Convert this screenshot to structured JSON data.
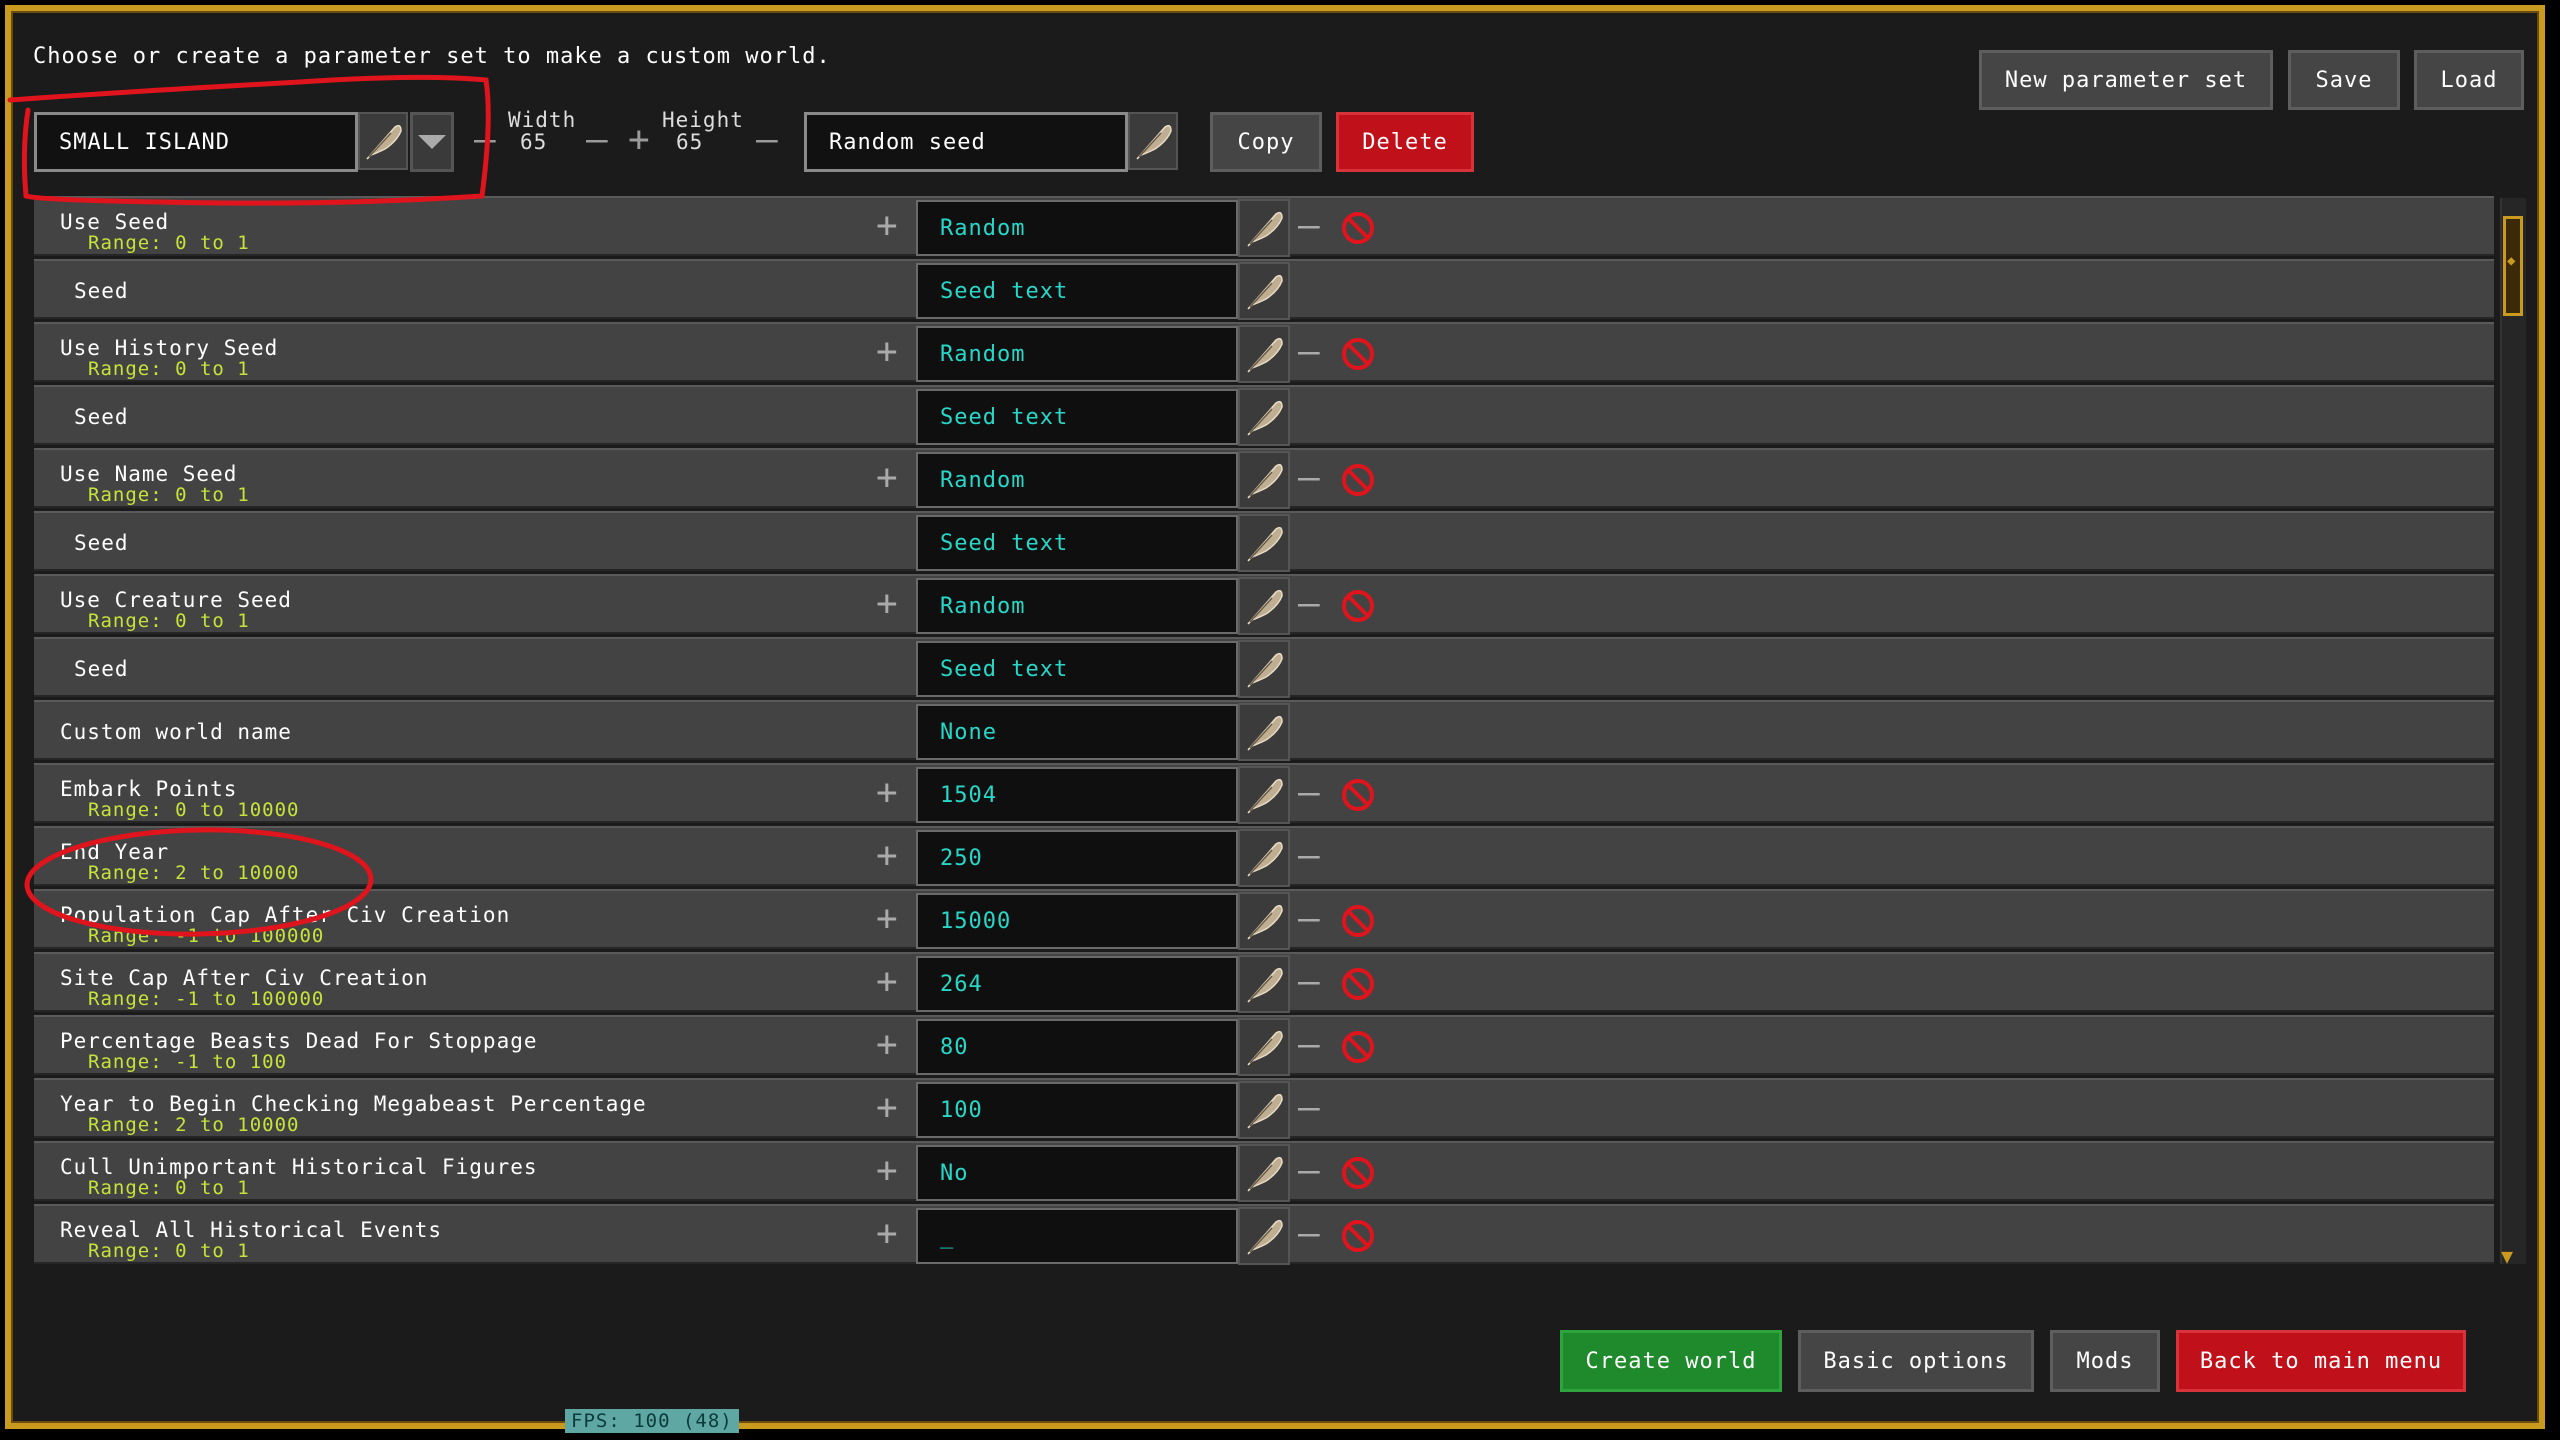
{
  "header": {
    "title": "Choose or create a parameter set to make a custom world.",
    "preset_name": "SMALL ISLAND",
    "width_label": "Width",
    "width_value": "65",
    "height_label": "Height",
    "height_value": "65",
    "seed_field": "Random seed",
    "copy_label": "Copy",
    "delete_label": "Delete",
    "new_param_label": "New parameter set",
    "save_label": "Save",
    "load_label": "Load"
  },
  "rows": [
    {
      "name": "Use Seed",
      "range": "Range: 0 to 1",
      "value": "Random",
      "has_plus": true,
      "has_minus": true,
      "has_forbid": true
    },
    {
      "name": "Seed",
      "range": "",
      "value": "Seed text",
      "has_plus": false,
      "has_minus": false,
      "has_forbid": false
    },
    {
      "name": "Use History Seed",
      "range": "Range: 0 to 1",
      "value": "Random",
      "has_plus": true,
      "has_minus": true,
      "has_forbid": true
    },
    {
      "name": "Seed",
      "range": "",
      "value": "Seed text",
      "has_plus": false,
      "has_minus": false,
      "has_forbid": false
    },
    {
      "name": "Use Name Seed",
      "range": "Range: 0 to 1",
      "value": "Random",
      "has_plus": true,
      "has_minus": true,
      "has_forbid": true
    },
    {
      "name": "Seed",
      "range": "",
      "value": "Seed text",
      "has_plus": false,
      "has_minus": false,
      "has_forbid": false
    },
    {
      "name": "Use Creature Seed",
      "range": "Range: 0 to 1",
      "value": "Random",
      "has_plus": true,
      "has_minus": true,
      "has_forbid": true
    },
    {
      "name": "Seed",
      "range": "",
      "value": "Seed text",
      "has_plus": false,
      "has_minus": false,
      "has_forbid": false
    },
    {
      "name": "Custom world name",
      "range": "",
      "value": "None",
      "has_plus": false,
      "has_minus": false,
      "has_forbid": false
    },
    {
      "name": "Embark Points",
      "range": "Range: 0 to 10000",
      "value": "1504",
      "has_plus": true,
      "has_minus": true,
      "has_forbid": true
    },
    {
      "name": "End Year",
      "range": "Range: 2 to 10000",
      "value": "250",
      "has_plus": true,
      "has_minus": true,
      "has_forbid": false
    },
    {
      "name": "Population Cap After Civ Creation",
      "range": "Range: -1 to 100000",
      "value": "15000",
      "has_plus": true,
      "has_minus": true,
      "has_forbid": true
    },
    {
      "name": "Site Cap After Civ Creation",
      "range": "Range: -1 to 100000",
      "value": "264",
      "has_plus": true,
      "has_minus": true,
      "has_forbid": true
    },
    {
      "name": "Percentage Beasts Dead For Stoppage",
      "range": "Range: -1 to 100",
      "value": "80",
      "has_plus": true,
      "has_minus": true,
      "has_forbid": true
    },
    {
      "name": "Year to Begin Checking Megabeast Percentage",
      "range": "Range: 2 to 10000",
      "value": "100",
      "has_plus": true,
      "has_minus": true,
      "has_forbid": false
    },
    {
      "name": "Cull Unimportant Historical Figures",
      "range": "Range: 0 to 1",
      "value": "No",
      "has_plus": true,
      "has_minus": true,
      "has_forbid": true
    },
    {
      "name": "Reveal All Historical Events",
      "range": "Range: 0 to 1",
      "value": "_",
      "has_plus": true,
      "has_minus": true,
      "has_forbid": true
    }
  ],
  "footer": {
    "create_world": "Create world",
    "basic_options": "Basic options",
    "mods": "Mods",
    "back_to_main": "Back to main menu",
    "fps": "FPS: 100 (48)"
  },
  "colors": {
    "frame": "#c99a1e",
    "value_text": "#27d8c9",
    "range_text": "#c6e33a",
    "annotation": "#e0141c"
  }
}
